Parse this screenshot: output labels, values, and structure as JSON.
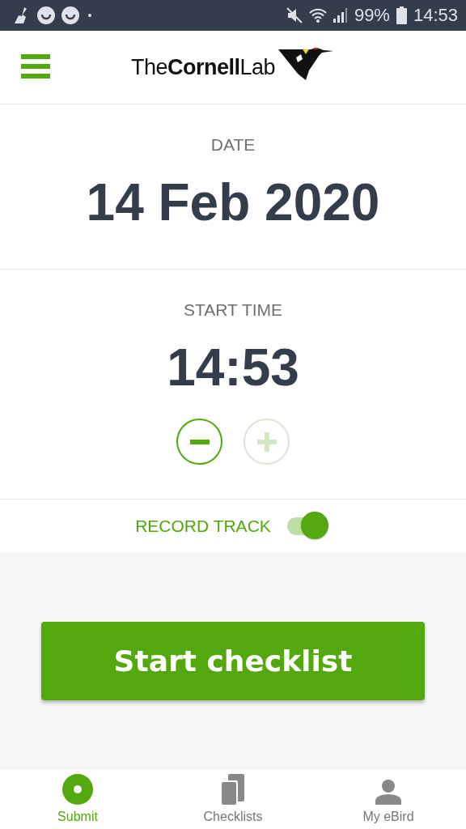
{
  "status_bar": {
    "battery": "99%",
    "time": "14:53"
  },
  "header": {
    "logo": "The**Cornell**Lab"
  },
  "date": {
    "label": "DATE",
    "value": "14 Feb 2020"
  },
  "start_time": {
    "label": "START TIME",
    "value": "14:53",
    "decrement": {
      "disabled": false
    },
    "increment": {
      "disabled": true
    }
  },
  "record_track": {
    "label": "RECORD TRACK",
    "on": true
  },
  "primary_button": "Start checklist",
  "bottom_nav": [
    {
      "label": "Submit",
      "kind": "submit",
      "selected": true
    },
    {
      "label": "Checklists",
      "kind": "checklists",
      "selected": false
    },
    {
      "label": "My eBird",
      "kind": "profile",
      "selected": false
    }
  ]
}
